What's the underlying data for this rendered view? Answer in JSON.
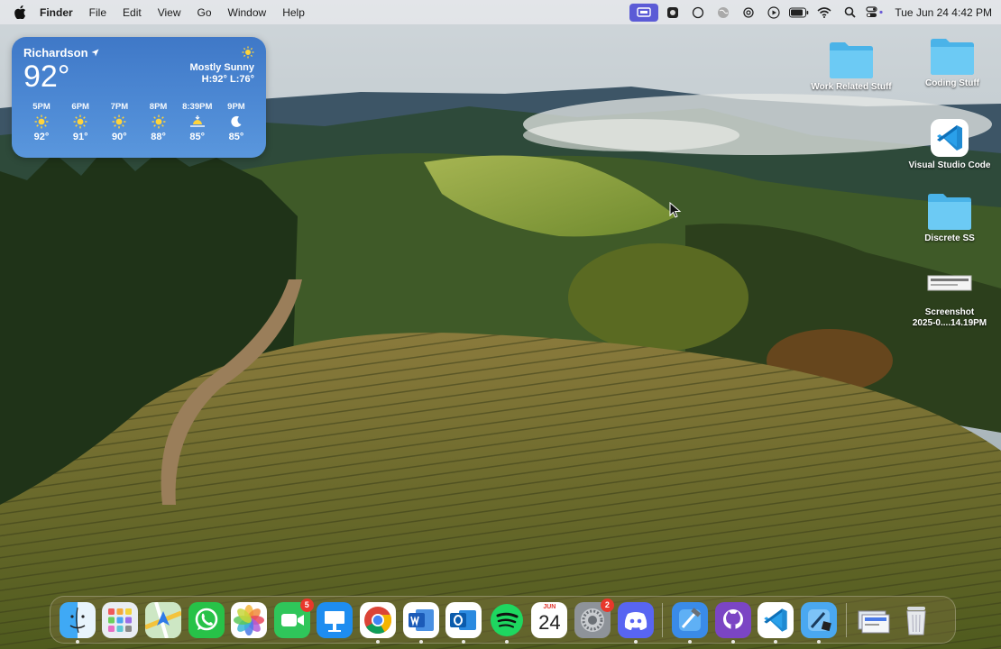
{
  "menubar": {
    "app_name": "Finder",
    "menus": [
      "File",
      "Edit",
      "View",
      "Go",
      "Window",
      "Help"
    ],
    "clock": "Tue Jun 24  4:42 PM",
    "status_icons": [
      "screen-mirroring-icon",
      "recorder-icon",
      "circle-icon",
      "globe-icon",
      "chatgpt-icon",
      "play-icon",
      "battery-icon",
      "wifi-icon",
      "search-icon",
      "control-center-icon"
    ]
  },
  "weather": {
    "city": "Richardson",
    "temperature": "92°",
    "condition": "Mostly Sunny",
    "high_low": "H:92° L:76°",
    "hourly": [
      {
        "time": "5PM",
        "icon": "sun-icon",
        "temp": "92°"
      },
      {
        "time": "6PM",
        "icon": "sun-icon",
        "temp": "91°"
      },
      {
        "time": "7PM",
        "icon": "sun-icon",
        "temp": "90°"
      },
      {
        "time": "8PM",
        "icon": "sun-icon",
        "temp": "88°"
      },
      {
        "time": "8:39PM",
        "icon": "sunset-icon",
        "temp": "85°"
      },
      {
        "time": "9PM",
        "icon": "moon-icon",
        "temp": "85°"
      }
    ]
  },
  "desktop": {
    "icons": [
      {
        "label": "Work Related Stuff",
        "type": "folder"
      },
      {
        "label": "Coding Stuff",
        "type": "folder"
      },
      {
        "label": "Visual Studio Code",
        "type": "app"
      },
      {
        "label": "Discrete SS",
        "type": "folder"
      },
      {
        "label_line1": "Screenshot",
        "label_line2": "2025-0....14.19PM",
        "type": "image"
      }
    ]
  },
  "dock": {
    "apps": [
      {
        "name": "Finder",
        "running": true
      },
      {
        "name": "Launchpad",
        "running": false
      },
      {
        "name": "Maps",
        "running": false
      },
      {
        "name": "WhatsApp",
        "running": false
      },
      {
        "name": "Photos",
        "running": false
      },
      {
        "name": "FaceTime",
        "running": false,
        "badge": "5"
      },
      {
        "name": "Keynote",
        "running": false
      },
      {
        "name": "Google Chrome",
        "running": true
      },
      {
        "name": "Microsoft Word",
        "running": true
      },
      {
        "name": "Microsoft Outlook",
        "running": true
      },
      {
        "name": "Spotify",
        "running": true
      },
      {
        "name": "Calendar",
        "running": false,
        "month": "JUN",
        "day": "24"
      },
      {
        "name": "System Settings",
        "running": false,
        "badge": "2"
      },
      {
        "name": "Discord",
        "running": true
      },
      {
        "name": "Xcode",
        "running": true
      },
      {
        "name": "GitHub Desktop",
        "running": true
      },
      {
        "name": "Visual Studio Code",
        "running": true
      },
      {
        "name": "Xcode Beta",
        "running": true
      },
      {
        "name": "Screenshot Preview",
        "running": false
      },
      {
        "name": "Trash",
        "running": false
      }
    ]
  }
}
